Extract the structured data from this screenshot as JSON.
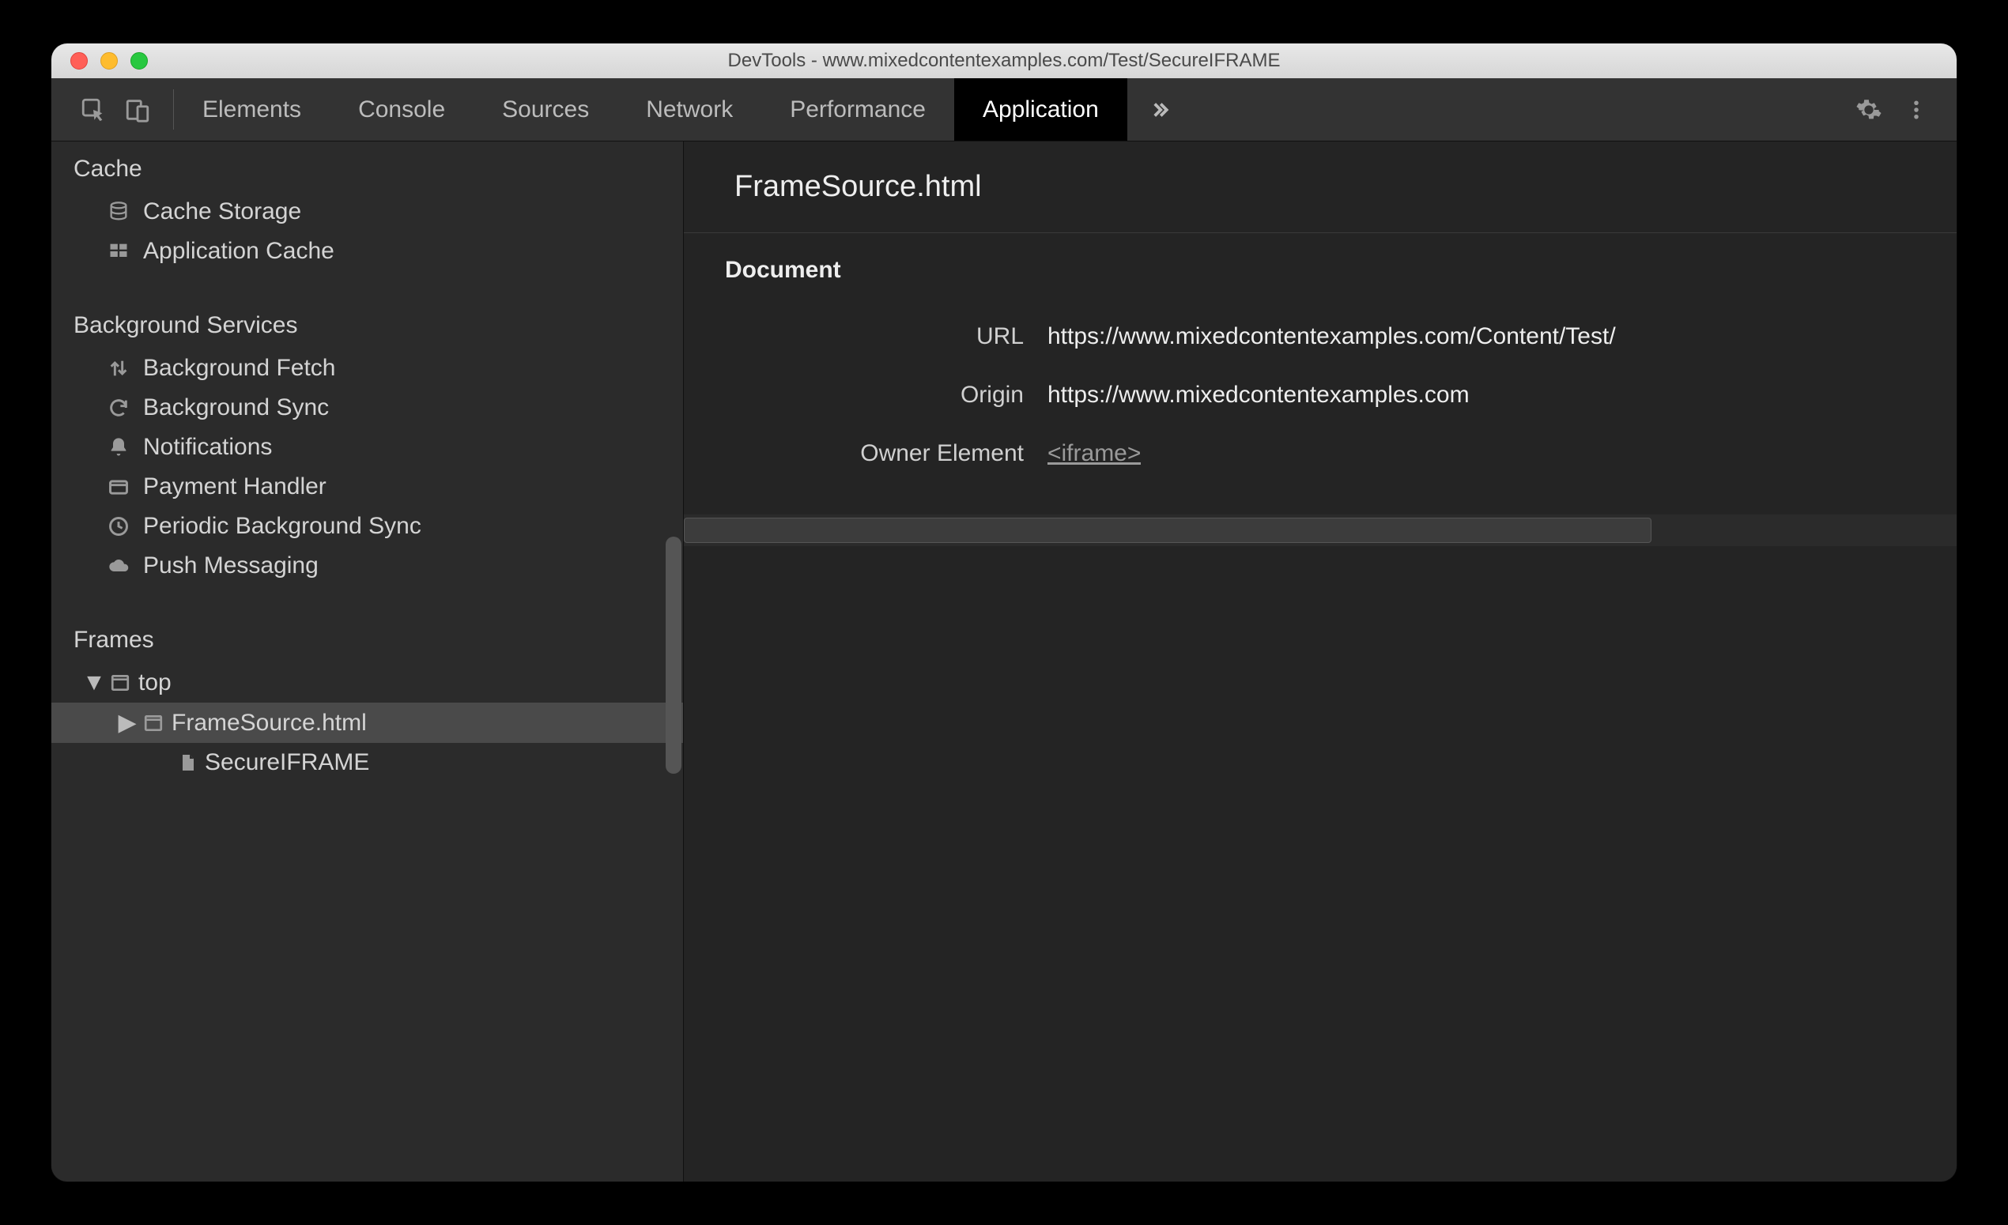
{
  "window": {
    "title": "DevTools - www.mixedcontentexamples.com/Test/SecureIFRAME"
  },
  "tabs": {
    "items": [
      {
        "label": "Elements",
        "active": false
      },
      {
        "label": "Console",
        "active": false
      },
      {
        "label": "Sources",
        "active": false
      },
      {
        "label": "Network",
        "active": false
      },
      {
        "label": "Performance",
        "active": false
      },
      {
        "label": "Application",
        "active": true
      }
    ]
  },
  "sidebar": {
    "sections": {
      "cache": {
        "title": "Cache",
        "items": [
          {
            "icon": "database",
            "label": "Cache Storage"
          },
          {
            "icon": "grid",
            "label": "Application Cache"
          }
        ]
      },
      "background": {
        "title": "Background Services",
        "items": [
          {
            "icon": "arrows-updown",
            "label": "Background Fetch"
          },
          {
            "icon": "sync",
            "label": "Background Sync"
          },
          {
            "icon": "bell",
            "label": "Notifications"
          },
          {
            "icon": "card",
            "label": "Payment Handler"
          },
          {
            "icon": "clock",
            "label": "Periodic Background Sync"
          },
          {
            "icon": "cloud",
            "label": "Push Messaging"
          }
        ]
      },
      "frames": {
        "title": "Frames",
        "tree": {
          "top": {
            "label": "top",
            "expanded": true
          },
          "frame": {
            "label": "FrameSource.html",
            "expanded": false,
            "selected": true
          },
          "doc": {
            "label": "SecureIFRAME"
          }
        }
      }
    }
  },
  "main": {
    "title": "FrameSource.html",
    "section": "Document",
    "rows": {
      "url": {
        "label": "URL",
        "value": "https://www.mixedcontentexamples.com/Content/Test/"
      },
      "origin": {
        "label": "Origin",
        "value": "https://www.mixedcontentexamples.com"
      },
      "owner": {
        "label": "Owner Element",
        "value": "<iframe>"
      }
    }
  }
}
